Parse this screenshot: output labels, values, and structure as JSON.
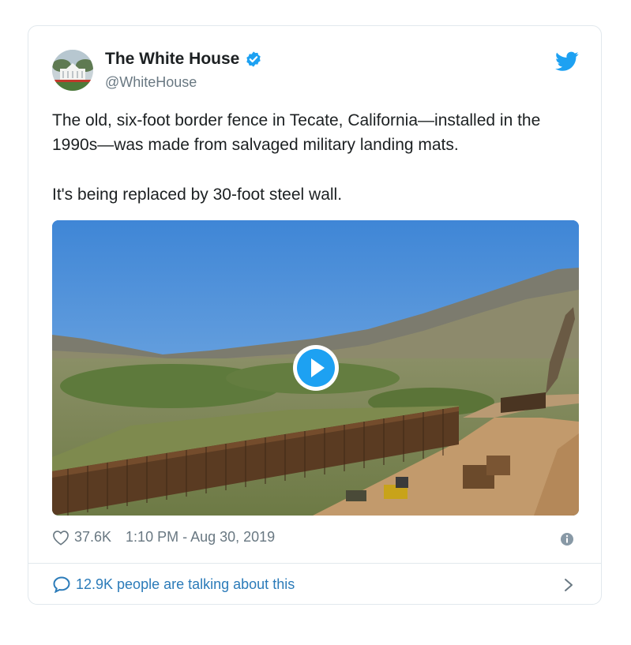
{
  "tweet": {
    "author_name": "The White House",
    "handle": "@WhiteHouse",
    "verified": true,
    "paragraphs": [
      "The old, six-foot border fence in Tecate, California—installed in the 1990s—was made from salvaged military landing mats.",
      "It's being replaced by 30-foot steel wall."
    ],
    "likes": "37.6K",
    "timestamp": "1:10 PM - Aug 30, 2019",
    "conversation_label": "12.9K people are talking about this"
  },
  "icons": {
    "brand": "twitter-bird-icon",
    "verified": "verified-badge-icon",
    "like": "heart-icon",
    "info": "info-icon",
    "reply": "speech-bubble-icon",
    "next": "chevron-right-icon",
    "media": "play-icon"
  },
  "colors": {
    "twitter_blue": "#1da1f2",
    "link_blue": "#2b7bb9",
    "muted": "#697882",
    "border": "#e1e8ed"
  }
}
